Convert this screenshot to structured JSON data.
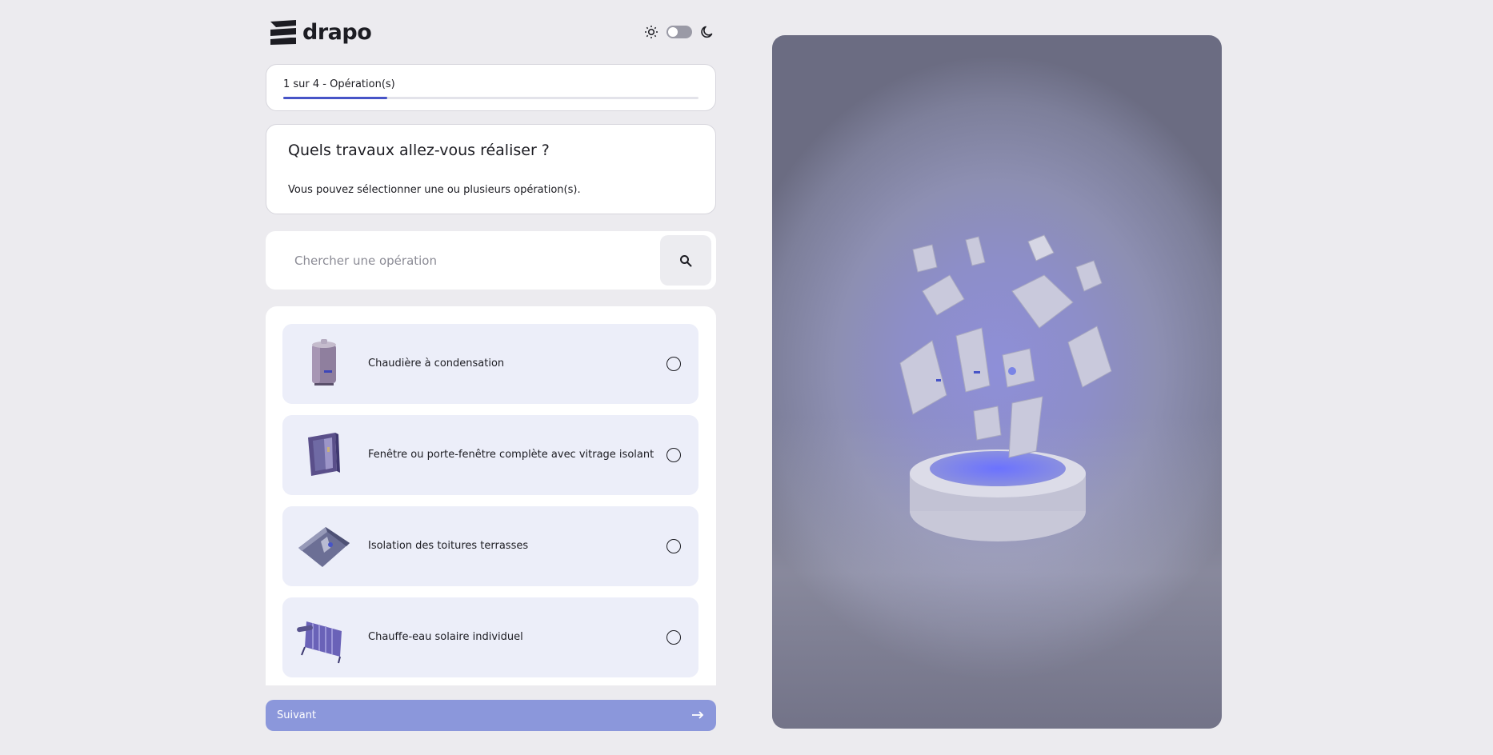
{
  "brand": {
    "name": "drapo"
  },
  "theme": {
    "light_icon": "sun-icon",
    "dark_icon": "moon-icon",
    "mode": "light"
  },
  "progress": {
    "label": "1 sur 4 - Opération(s)",
    "step": 1,
    "total": 4,
    "fraction": 0.25
  },
  "question": {
    "title": "Quels travaux allez-vous réaliser ?",
    "subtitle": "Vous pouvez sélectionner une ou plusieurs opération(s)."
  },
  "search": {
    "placeholder": "Chercher une opération",
    "value": "",
    "icon": "search-icon"
  },
  "operations": [
    {
      "label": "Chaudière à condensation",
      "icon": "boiler-icon",
      "selected": false
    },
    {
      "label": "Fenêtre ou porte-fenêtre complète avec vitrage isolant",
      "icon": "window-icon",
      "selected": false
    },
    {
      "label": "Isolation des toitures terrasses",
      "icon": "roof-icon",
      "selected": false
    },
    {
      "label": "Chauffe-eau solaire individuel",
      "icon": "solar-panel-icon",
      "selected": false
    }
  ],
  "next_button": {
    "label": "Suivant",
    "icon": "arrow-right-icon"
  },
  "colors": {
    "accent": "#4754c7",
    "button": "#8b97db",
    "item_bg": "#eceef9",
    "page_bg": "#ecebef"
  }
}
